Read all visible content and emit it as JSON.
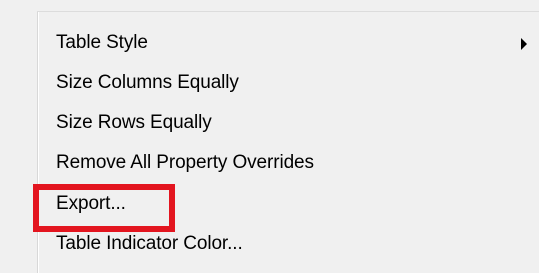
{
  "context_menu": {
    "items": [
      {
        "label": "Table Style",
        "has_submenu": true
      },
      {
        "label": "Size Columns Equally",
        "has_submenu": false
      },
      {
        "label": "Size Rows Equally",
        "has_submenu": false
      },
      {
        "label": "Remove All Property Overrides",
        "has_submenu": false
      },
      {
        "label": "Export...",
        "has_submenu": false,
        "highlighted": true
      },
      {
        "label": "Table Indicator Color...",
        "has_submenu": false
      }
    ],
    "highlight_color": "#e3151f",
    "background_color": "#f0f0f0",
    "submenu_icon": "chevron-right-icon"
  }
}
